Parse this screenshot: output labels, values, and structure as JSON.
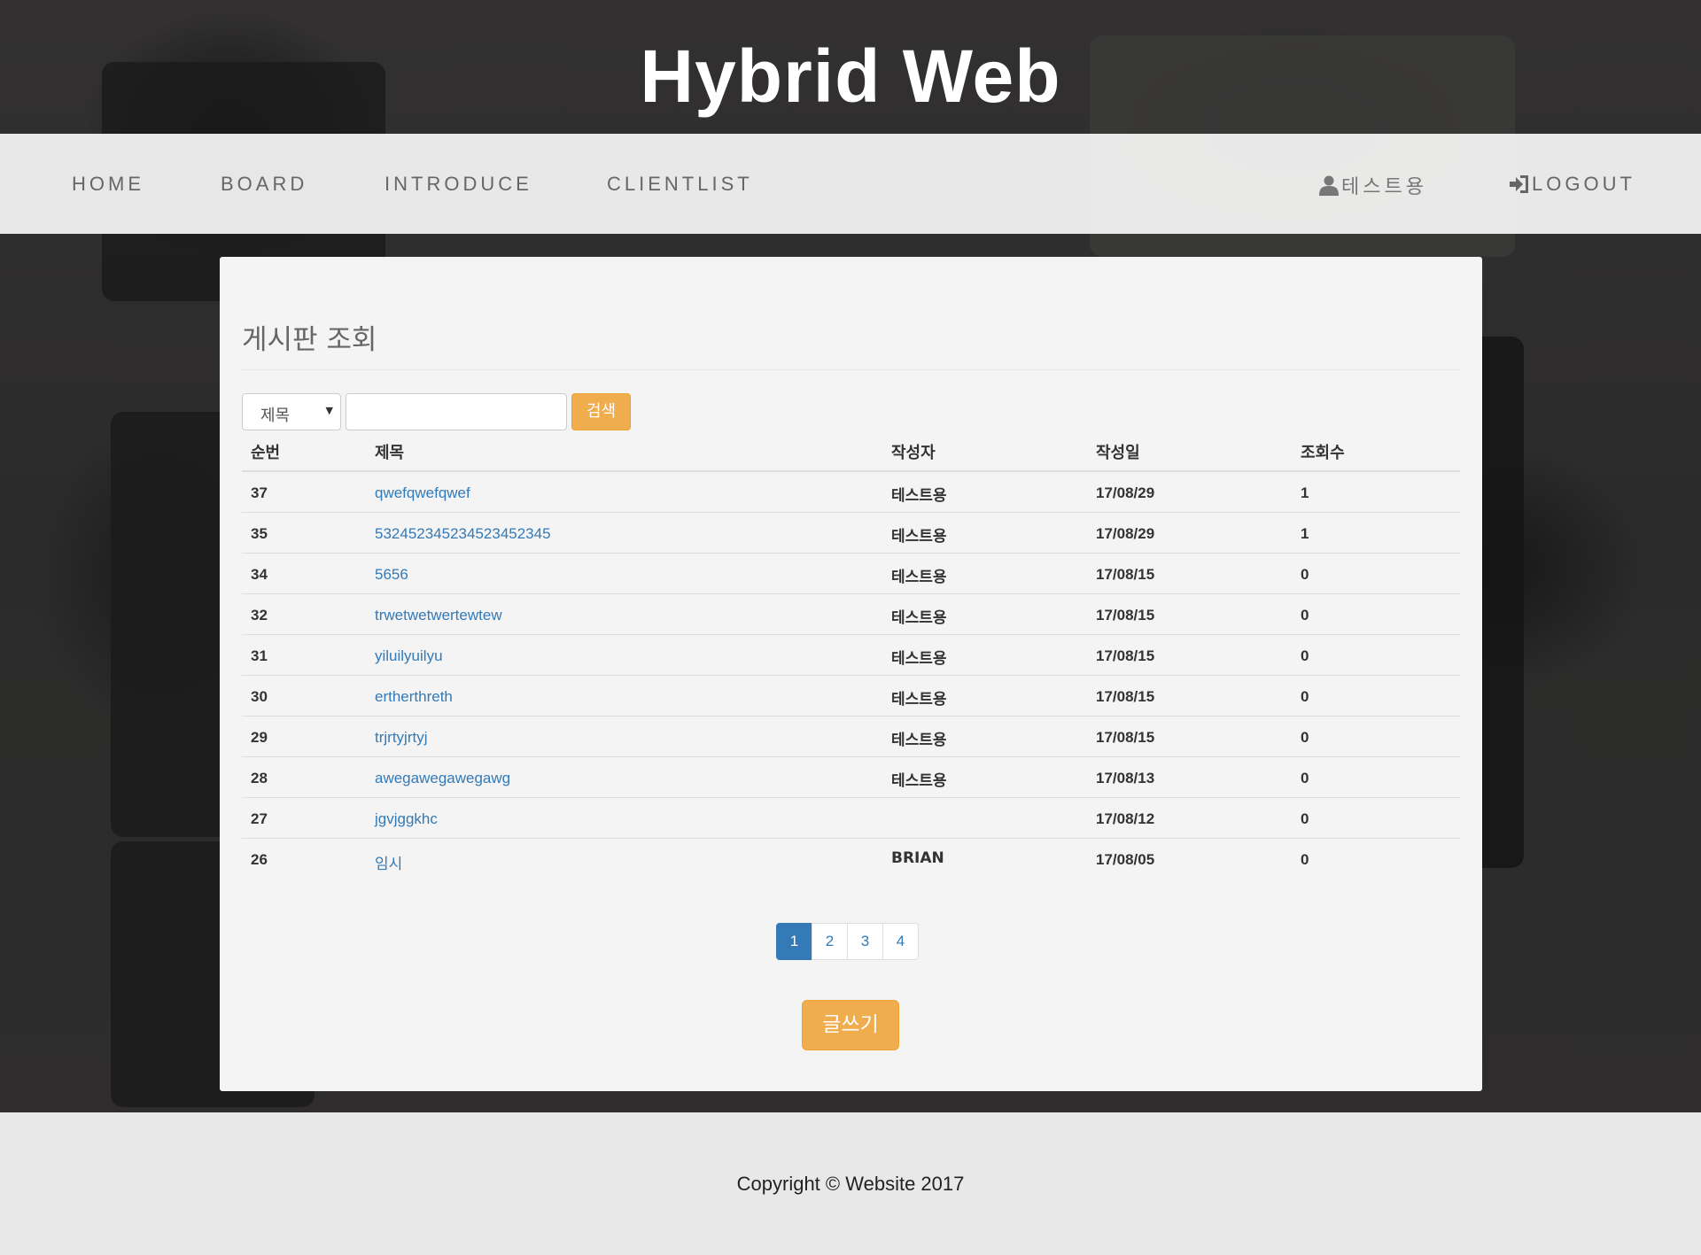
{
  "site": {
    "title": "Hybrid Web"
  },
  "nav": {
    "items": [
      "HOME",
      "BOARD",
      "INTRODUCE",
      "CLIENTLIST"
    ],
    "user_label": "테스트용",
    "logout_label": "LOGOUT"
  },
  "board": {
    "heading": "게시판 조회",
    "search": {
      "select_value": "제목",
      "input_value": "",
      "button_label": "검색"
    },
    "columns": [
      "순번",
      "제목",
      "작성자",
      "작성일",
      "조회수"
    ],
    "rows": [
      [
        "37",
        "qwefqwefqwef",
        "테스트용",
        "17/08/29",
        "1"
      ],
      [
        "35",
        "532452345234523452345",
        "테스트용",
        "17/08/29",
        "1"
      ],
      [
        "34",
        "5656",
        "테스트용",
        "17/08/15",
        "0"
      ],
      [
        "32",
        "trwetwetwertewtew",
        "테스트용",
        "17/08/15",
        "0"
      ],
      [
        "31",
        "yiluilyuilyu",
        "테스트용",
        "17/08/15",
        "0"
      ],
      [
        "30",
        "ertherthreth",
        "테스트용",
        "17/08/15",
        "0"
      ],
      [
        "29",
        "trjrtyjrtyj",
        "테스트용",
        "17/08/15",
        "0"
      ],
      [
        "28",
        "awegawegawegawg",
        "테스트용",
        "17/08/13",
        "0"
      ],
      [
        "27",
        "jgvjggkhc",
        "",
        "17/08/12",
        "0"
      ],
      [
        "26",
        "임시",
        "BRIAN",
        "17/08/05",
        "0"
      ]
    ],
    "pages": [
      "1",
      "2",
      "3",
      "4"
    ],
    "current_page": "1",
    "write_button": "글쓰기"
  },
  "footer": {
    "text": "Copyright © Website 2017"
  },
  "colors": {
    "accent": "#f0ad4e",
    "link": "#337ab7",
    "primary": "#337ab7"
  },
  "icons": {
    "user": "user-icon",
    "logout": "logout-icon"
  }
}
